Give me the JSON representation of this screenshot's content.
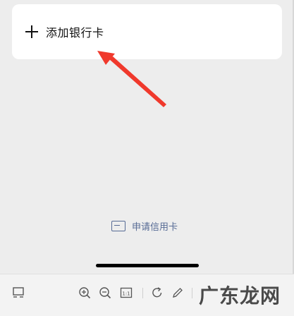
{
  "add_card": {
    "label": "添加银行卡",
    "icon": "plus-icon"
  },
  "apply_credit_card": {
    "label": "申请信用卡",
    "icon": "card-icon",
    "color": "#576b95"
  },
  "annotation": {
    "color": "#f0392c"
  },
  "toolbar": {
    "fit_label": "1:1"
  },
  "watermark": {
    "text": "广东龙网"
  }
}
